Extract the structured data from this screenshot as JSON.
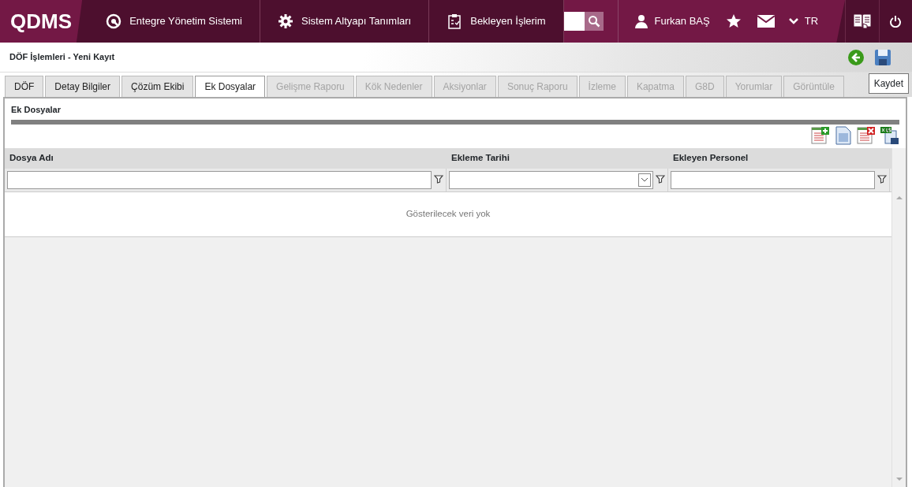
{
  "navbar": {
    "logo": "QDMS",
    "menu": [
      {
        "label": "Entegre Yönetim Sistemi",
        "kind": "q"
      },
      {
        "label": "Sistem Altyapı Tanımları",
        "kind": "gear"
      },
      {
        "label": "Bekleyen İşlerim",
        "kind": "clipboard"
      }
    ],
    "user": "Furkan BAŞ",
    "language": "TR"
  },
  "page": {
    "title": "DÖF İşlemleri - Yeni Kayıt",
    "tooltip": "Kaydet"
  },
  "tabs": [
    {
      "label": "DÖF",
      "selected": false,
      "disabled": false
    },
    {
      "label": "Detay Bilgiler",
      "selected": false,
      "disabled": false
    },
    {
      "label": "Çözüm Ekibi",
      "selected": false,
      "disabled": false
    },
    {
      "label": "Ek Dosyalar",
      "selected": true,
      "disabled": false
    },
    {
      "label": "Gelişme Raporu",
      "selected": false,
      "disabled": true
    },
    {
      "label": "Kök Nedenler",
      "selected": false,
      "disabled": true
    },
    {
      "label": "Aksiyonlar",
      "selected": false,
      "disabled": true
    },
    {
      "label": "Sonuç Raporu",
      "selected": false,
      "disabled": true
    },
    {
      "label": "İzleme",
      "selected": false,
      "disabled": true
    },
    {
      "label": "Kapatma",
      "selected": false,
      "disabled": true
    },
    {
      "label": "G8D",
      "selected": false,
      "disabled": true
    },
    {
      "label": "Yorumlar",
      "selected": false,
      "disabled": true
    },
    {
      "label": "Görüntüle",
      "selected": false,
      "disabled": true
    }
  ],
  "section": {
    "title": "Ek Dosyalar"
  },
  "table": {
    "columns": [
      {
        "label": "Dosya Adı",
        "kind": "text"
      },
      {
        "label": "Ekleme Tarihi",
        "kind": "date"
      },
      {
        "label": "Ekleyen Personel",
        "kind": "text"
      }
    ],
    "empty_message": "Gösterilecek veri yok"
  }
}
